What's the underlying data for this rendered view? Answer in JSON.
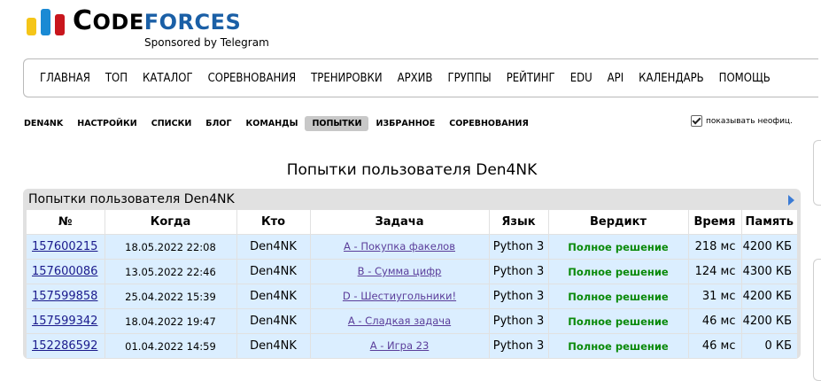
{
  "logo": {
    "brand_first": "C",
    "brand_code": "ODE",
    "brand_forces": "FORCES",
    "sponsor": "Sponsored by Telegram",
    "bar_colors": [
      "#f5c518",
      "#1a8ad4",
      "#c8161d"
    ]
  },
  "menu": {
    "items": [
      "ГЛАВНАЯ",
      "ТОП",
      "КАТАЛОГ",
      "СОРЕВНОВАНИЯ",
      "ТРЕНИРОВКИ",
      "АРХИВ",
      "ГРУППЫ",
      "РЕЙТИНГ",
      "EDU",
      "API",
      "КАЛЕНДАРЬ",
      "ПОМОЩЬ"
    ]
  },
  "subnav": {
    "items": [
      "DEN4NK",
      "НАСТРОЙКИ",
      "СПИСКИ",
      "БЛОГ",
      "КОМАНДЫ",
      "ПОПЫТКИ",
      "ИЗБРАННОЕ",
      "СОРЕВНОВАНИЯ"
    ],
    "active": "ПОПЫТКИ"
  },
  "unofficial": {
    "label": "показывать неофиц.",
    "checked": true
  },
  "page_title": "Попытки пользователя Den4NK",
  "panel": {
    "title": "Попытки пользователя Den4NK",
    "columns": [
      "№",
      "Когда",
      "Кто",
      "Задача",
      "Язык",
      "Вердикт",
      "Время",
      "Память"
    ],
    "rows": [
      {
        "id": "157600215",
        "when": "18.05.2022 22:08",
        "who": "Den4NK",
        "problem": "A - Покупка факелов",
        "lang": "Python 3",
        "verdict": "Полное решение",
        "time": "218 мс",
        "memory": "4200 КБ"
      },
      {
        "id": "157600086",
        "when": "13.05.2022 22:46",
        "who": "Den4NK",
        "problem": "B - Сумма цифр",
        "lang": "Python 3",
        "verdict": "Полное решение",
        "time": "124 мс",
        "memory": "4300 КБ"
      },
      {
        "id": "157599858",
        "when": "25.04.2022 15:39",
        "who": "Den4NK",
        "problem": "D - Шестиугольники!",
        "lang": "Python 3",
        "verdict": "Полное решение",
        "time": "31 мс",
        "memory": "4200 КБ"
      },
      {
        "id": "157599342",
        "when": "18.04.2022 19:47",
        "who": "Den4NK",
        "problem": "A - Сладкая задача",
        "lang": "Python 3",
        "verdict": "Полное решение",
        "time": "46 мс",
        "memory": "4200 КБ"
      },
      {
        "id": "152286592",
        "when": "01.04.2022 14:59",
        "who": "Den4NK",
        "problem": "A - Игра 23",
        "lang": "Python 3",
        "verdict": "Полное решение",
        "time": "46 мс",
        "memory": "0 КБ"
      }
    ]
  },
  "colors": {
    "row_bg": "#dbeeff",
    "verdict_ok": "#0a8a0a",
    "link": "#1a1a8c",
    "panel_bg": "#e1e1e1",
    "brand_blue": "#1a5fa6"
  }
}
